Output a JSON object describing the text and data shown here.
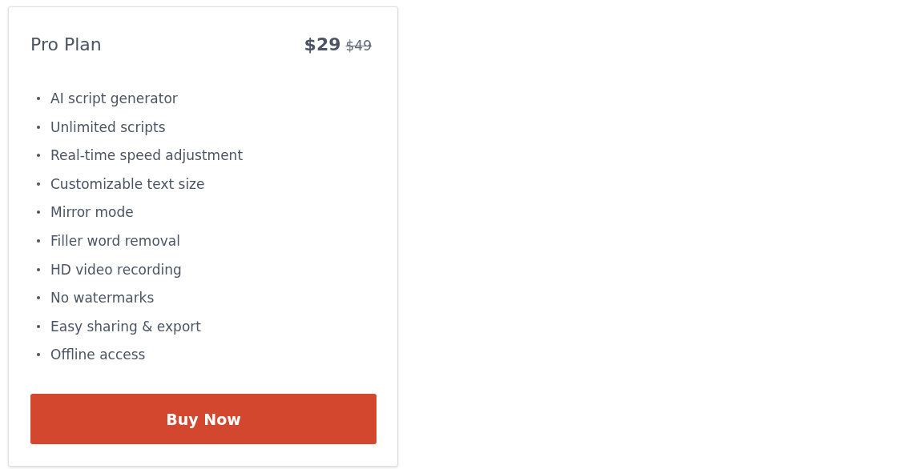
{
  "plan": {
    "title": "Pro Plan",
    "price": "$29",
    "old_price": "$49"
  },
  "features": [
    "AI script generator",
    "Unlimited scripts",
    "Real-time speed adjustment",
    "Customizable text size",
    "Mirror mode",
    "Filler word removal",
    "HD video recording",
    "No watermarks",
    "Easy sharing & export",
    "Offline access"
  ],
  "button": {
    "label": "Buy Now"
  }
}
